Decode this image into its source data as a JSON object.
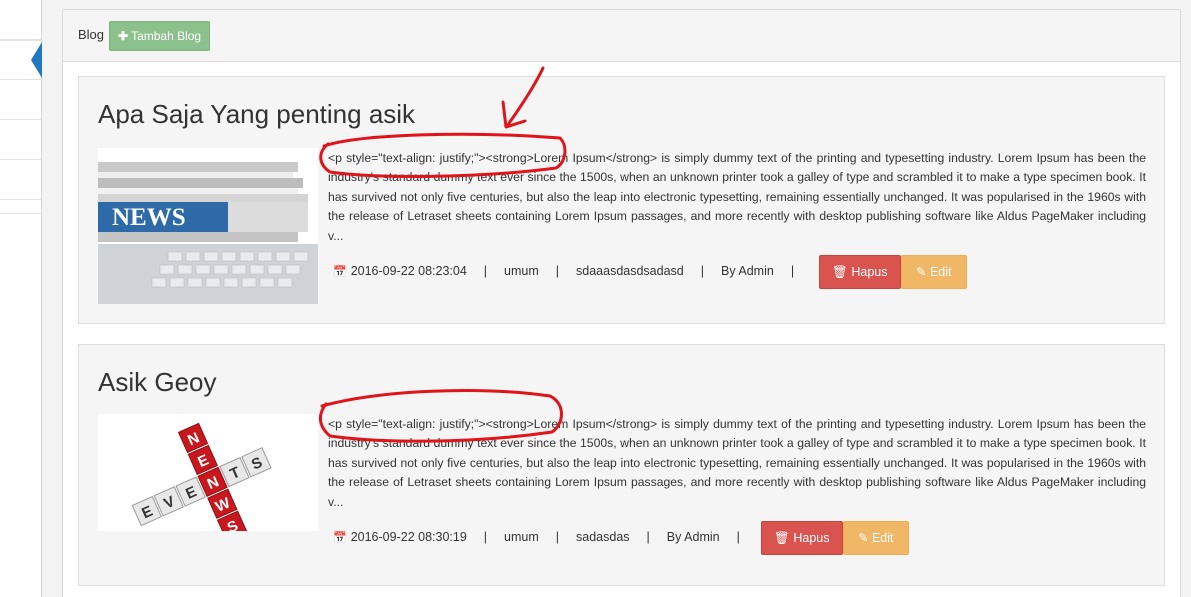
{
  "header": {
    "title": "Blog",
    "add_button_label": "Tambah Blog"
  },
  "posts": [
    {
      "title": "Apa Saja Yang penting asik",
      "excerpt": "<p style=\"text-align: justify;\"><strong>Lorem Ipsum</strong> is simply dummy text of the printing and typesetting industry. Lorem Ipsum has been the industry's standard dummy text ever since the 1500s, when an unknown printer took a galley of type and scrambled it to make a type specimen book. It has survived not only five centuries, but also the leap into electronic typesetting, remaining essentially unchanged. It was popularised in the 1960s with the release of Letraset sheets containing Lorem Ipsum passages, and more recently with desktop publishing software like Aldus PageMaker including v...",
      "date": "2016-09-22 08:23:04",
      "category": "umum",
      "tags": "sdaaasdasdsadasd",
      "author": "By Admin",
      "thumbnail_text": "NEWS",
      "delete_label": "Hapus",
      "edit_label": "Edit"
    },
    {
      "title": "Asik Geoy",
      "excerpt": "<p style=\"text-align: justify;\"><strong>Lorem Ipsum</strong> is simply dummy text of the printing and typesetting industry. Lorem Ipsum has been the industry's standard dummy text ever since the 1500s, when an unknown printer took a galley of type and scrambled it to make a type specimen book. It has survived not only five centuries, but also the leap into electronic typesetting, remaining essentially unchanged. It was popularised in the 1960s with the release of Letraset sheets containing Lorem Ipsum passages, and more recently with desktop publishing software like Aldus PageMaker including v...",
      "date": "2016-09-22 08:30:19",
      "category": "umum",
      "tags": "sadasdas",
      "author": "By Admin",
      "thumbnail_text_across": "EVENTS",
      "thumbnail_text_down": "NEWS",
      "delete_label": "Hapus",
      "edit_label": "Edit"
    }
  ],
  "colors": {
    "add_button": "#8cc08c",
    "delete_button": "#d9534f",
    "edit_button": "#f0ad4e",
    "annotation": "#e0141a",
    "sidebar_accent": "#1f78c1"
  },
  "icons": {
    "add": "plus-icon",
    "date": "calendar-icon",
    "delete": "trash-icon",
    "edit": "edit-icon"
  }
}
